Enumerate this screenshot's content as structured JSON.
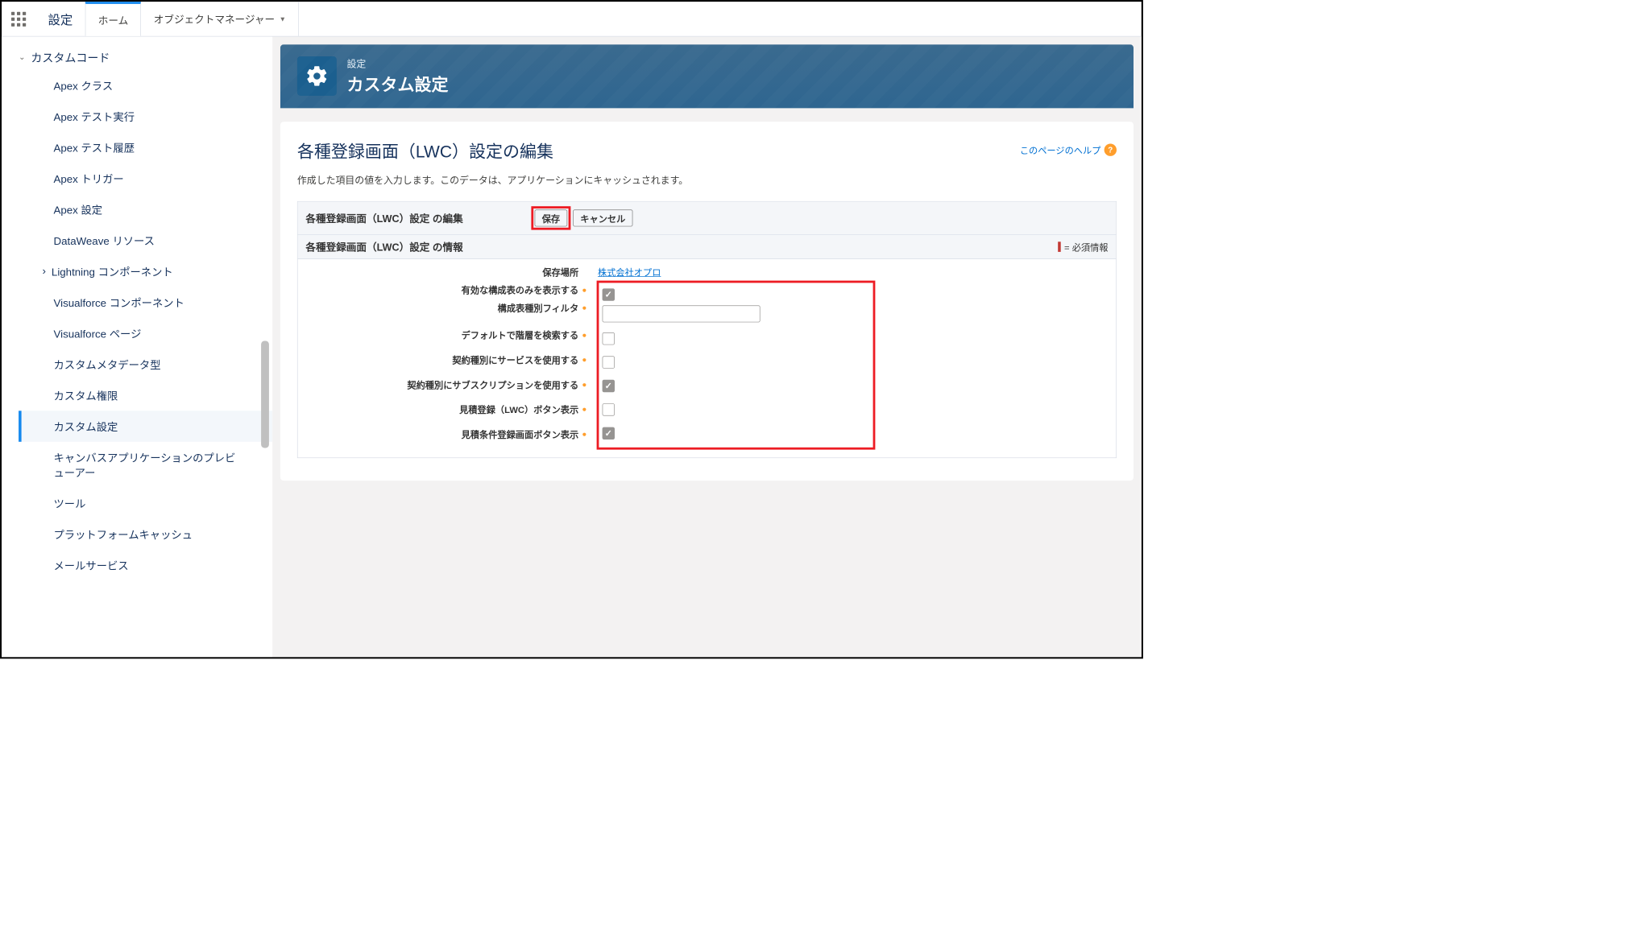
{
  "header": {
    "app_name": "設定",
    "tabs": [
      {
        "label": "ホーム",
        "active": true
      },
      {
        "label": "オブジェクトマネージャー",
        "active": false
      }
    ]
  },
  "sidebar": {
    "section": "カスタムコード",
    "items": [
      {
        "label": "Apex クラス"
      },
      {
        "label": "Apex テスト実行"
      },
      {
        "label": "Apex テスト履歴"
      },
      {
        "label": "Apex トリガー"
      },
      {
        "label": "Apex 設定"
      },
      {
        "label": "DataWeave リソース"
      },
      {
        "label": "Lightning コンポーネント",
        "has_children": true
      },
      {
        "label": "Visualforce コンポーネント"
      },
      {
        "label": "Visualforce ページ"
      },
      {
        "label": "カスタムメタデータ型"
      },
      {
        "label": "カスタム権限"
      },
      {
        "label": "カスタム設定",
        "active": true
      },
      {
        "label": "キャンバスアプリケーションのプレビューアー"
      },
      {
        "label": "ツール"
      },
      {
        "label": "プラットフォームキャッシュ"
      },
      {
        "label": "メールサービス"
      }
    ]
  },
  "page": {
    "breadcrumb_label": "設定",
    "title": "カスタム設定"
  },
  "card": {
    "title": "各種登録画面（LWC）設定の編集",
    "help_label": "このページのヘルプ",
    "description": "作成した項目の値を入力します。このデータは、アプリケーションにキャッシュされます。"
  },
  "form": {
    "header_label": "各種登録画面（LWC）設定 の編集",
    "save_label": "保存",
    "cancel_label": "キャンセル",
    "info_label": "各種登録画面（LWC）設定 の情報",
    "required_label": "= 必須情報",
    "location_label": "保存場所",
    "location_value": "株式会社オプロ",
    "fields": [
      {
        "label": "有効な構成表のみを表示する",
        "type": "checkbox",
        "checked": true
      },
      {
        "label": "構成表種別フィルタ",
        "type": "text",
        "value": ""
      },
      {
        "label": "デフォルトで階層を検索する",
        "type": "checkbox",
        "checked": false
      },
      {
        "label": "契約種別にサービスを使用する",
        "type": "checkbox",
        "checked": false
      },
      {
        "label": "契約種別にサブスクリプションを使用する",
        "type": "checkbox",
        "checked": true
      },
      {
        "label": "見積登録（LWC）ボタン表示",
        "type": "checkbox",
        "checked": false
      },
      {
        "label": "見積条件登録画面ボタン表示",
        "type": "checkbox",
        "checked": true
      }
    ]
  }
}
